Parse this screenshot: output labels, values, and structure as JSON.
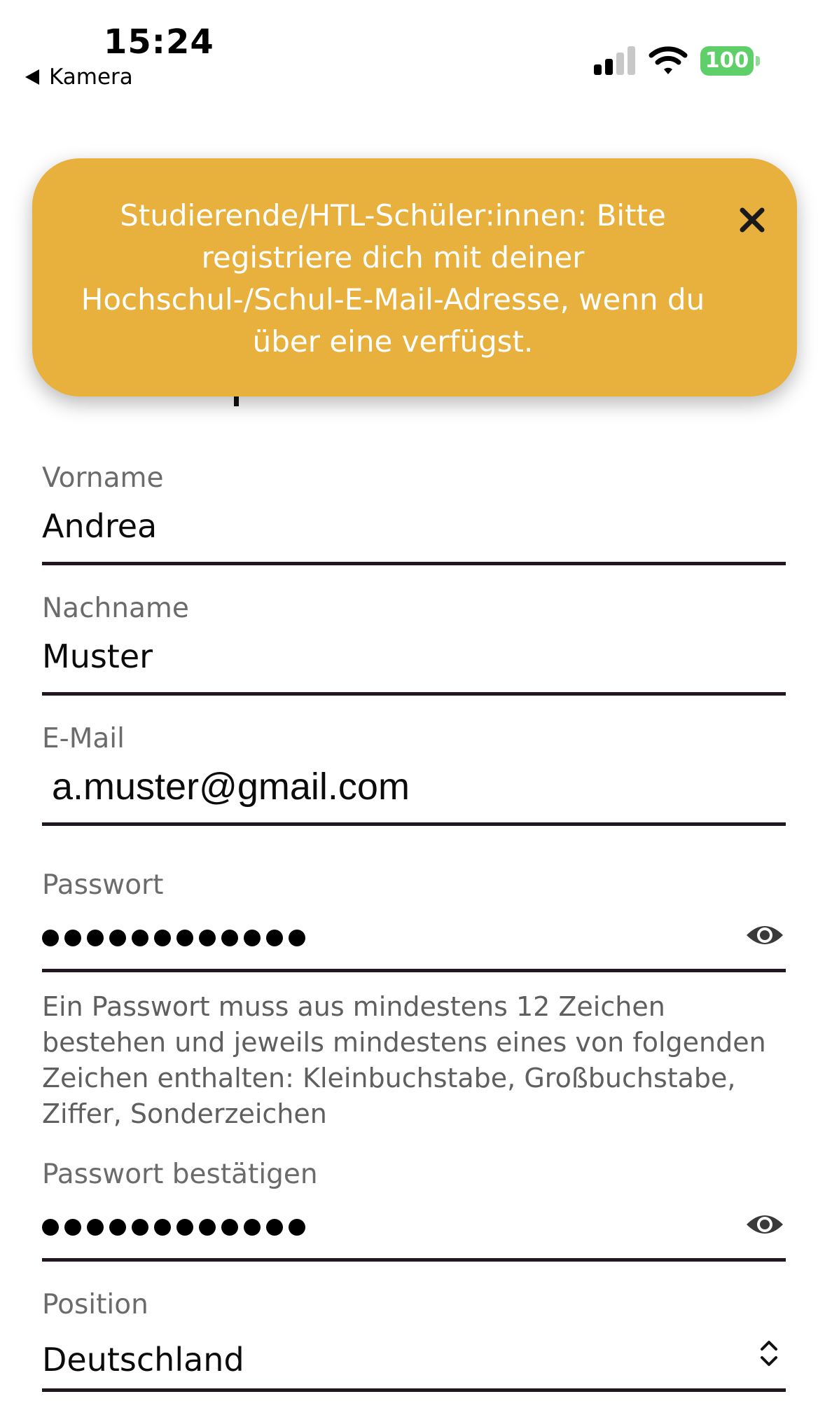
{
  "status_bar": {
    "time": "15:24",
    "back_label": "Kamera",
    "battery_level": "100",
    "signal_bars_active": 2,
    "signal_bars_total": 4,
    "colors": {
      "battery": "#5fcf6a"
    }
  },
  "banner": {
    "message": "Studierende/HTL-Schüler:innen: Bitte registriere dich mit deiner Hochschul-/Schul-E-Mail-Adresse, wenn du über eine verfügst.",
    "close_icon": "close-icon",
    "colors": {
      "background": "#e8b03d",
      "text": "#ffffff"
    }
  },
  "form": {
    "first_name": {
      "label": "Vorname",
      "value": "Andrea"
    },
    "last_name": {
      "label": "Nachname",
      "value": "Muster"
    },
    "email": {
      "label": "E-Mail",
      "value": "a.muster@gmail.com"
    },
    "password": {
      "label": "Passwort",
      "masked_length": 12,
      "toggle_icon": "eye-icon",
      "helper": "Ein Passwort muss aus mindestens 12 Zeichen bestehen und jeweils mindestens eines von folgenden Zeichen enthalten: Kleinbuchstabe, Großbuchstabe, Ziffer, Sonderzeichen"
    },
    "password_confirm": {
      "label": "Passwort bestätigen",
      "masked_length": 12,
      "toggle_icon": "eye-icon"
    },
    "position": {
      "label": "Position",
      "value": "Deutschland",
      "select_icon": "chevron-up-down-icon"
    }
  },
  "colors": {
    "underline": "#22161f",
    "label": "#6b6b6b"
  }
}
